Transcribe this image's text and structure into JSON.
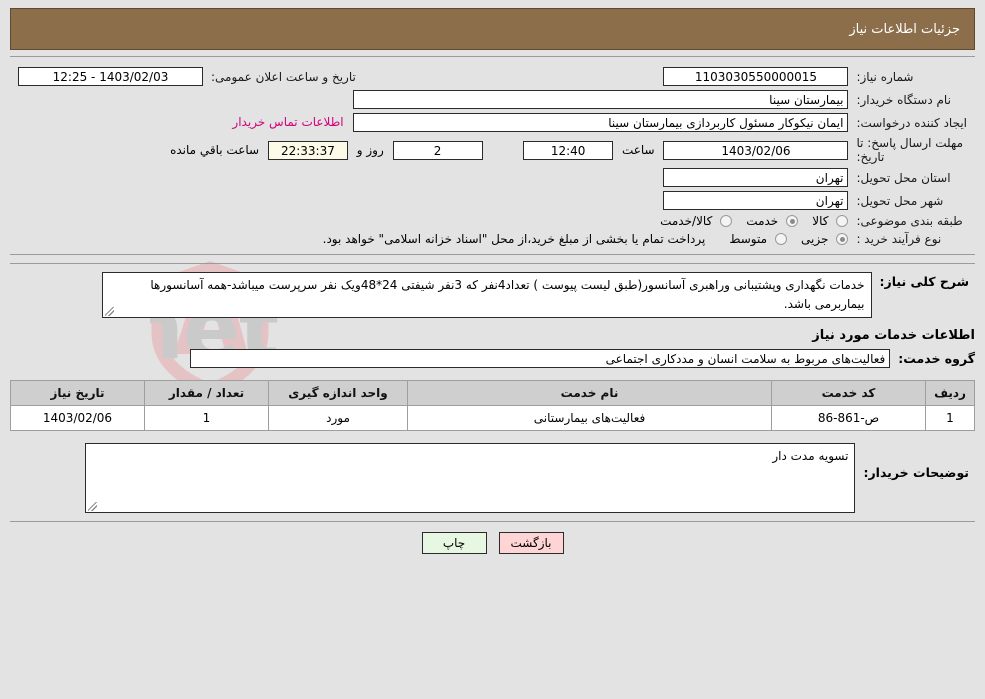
{
  "header": {
    "title": "جزئیات اطلاعات نیاز"
  },
  "form": {
    "need_no_label": "شماره نیاز:",
    "need_no_value": "1103030550000015",
    "announce_label": "تاریخ و ساعت اعلان عمومی:",
    "announce_value": "1403/02/03 - 12:25",
    "buyer_org_label": "نام دستگاه خریدار:",
    "buyer_org_value": "بیمارستان سینا",
    "creator_label": "ایجاد کننده درخواست:",
    "creator_value": "ایمان نیکوکار مسئول کاربردازی  بیمارستان سینا",
    "contact_link": "اطلاعات تماس خریدار",
    "deadline_label": "مهلت ارسال پاسخ: تا تاریخ:",
    "deadline_date": "1403/02/06",
    "hour_label": "ساعت",
    "deadline_time": "12:40",
    "days_value": "2",
    "days_label": "روز و",
    "countdown_value": "22:33:37",
    "countdown_label": "ساعت باقي مانده",
    "province_label": "استان محل تحویل:",
    "province_value": "تهران",
    "city_label": "شهر محل تحویل:",
    "city_value": "تهران",
    "category_label": "طبقه بندی موضوعی:",
    "category_options": [
      {
        "label": "کالا",
        "selected": false
      },
      {
        "label": "خدمت",
        "selected": true
      },
      {
        "label": "کالا/خدمت",
        "selected": false
      }
    ],
    "process_label": "نوع فرآیند خرید :",
    "process_options": [
      {
        "label": "جزیی",
        "selected": true
      },
      {
        "label": "متوسط",
        "selected": false
      }
    ],
    "payment_notice": "پرداخت تمام یا بخشی از مبلغ خرید،از محل \"اسناد خزانه اسلامی\" خواهد بود."
  },
  "description": {
    "label": "شرح کلی نیاز:",
    "value": "خدمات نگهداری وپشتیبانی وراهبری آسانسور(طبق لیست پیوست ) تعداد4نفر که 3نفر شیفتی 24*48ویک نفر سرپرست میباشد-همه آسانسورها بیماربرمی باشد."
  },
  "services_section": {
    "heading": "اطلاعات خدمات مورد نیاز",
    "group_label": "گروه خدمت:",
    "group_value": "فعالیت‌های مربوط به سلامت انسان و مددکاری اجتماعی"
  },
  "items_table": {
    "columns": [
      "ردیف",
      "کد خدمت",
      "نام خدمت",
      "واحد اندازه گیری",
      "تعداد / مقدار",
      "تاریخ نیاز"
    ],
    "rows": [
      {
        "row_no": "1",
        "service_code": "ص-861-86",
        "service_name": "فعالیت‌های بیمارستانی",
        "unit": "مورد",
        "quantity": "1",
        "need_date": "1403/02/06"
      }
    ]
  },
  "notes": {
    "label": "توضیحات خریدار:",
    "value": "تسویه مدت دار"
  },
  "footer": {
    "back_label": "بازگشت",
    "print_label": "چاپ"
  },
  "watermark": {
    "text": "AriaTender.net"
  },
  "colors": {
    "header_bg": "#8d6e4b",
    "page_bg": "#e3e3e3",
    "link": "#d3007d",
    "back_btn": "#ffd4d4",
    "print_btn": "#e6f7e2",
    "countdown_bg": "#fbfbe8",
    "table_header_bg": "#cfcfcf"
  }
}
